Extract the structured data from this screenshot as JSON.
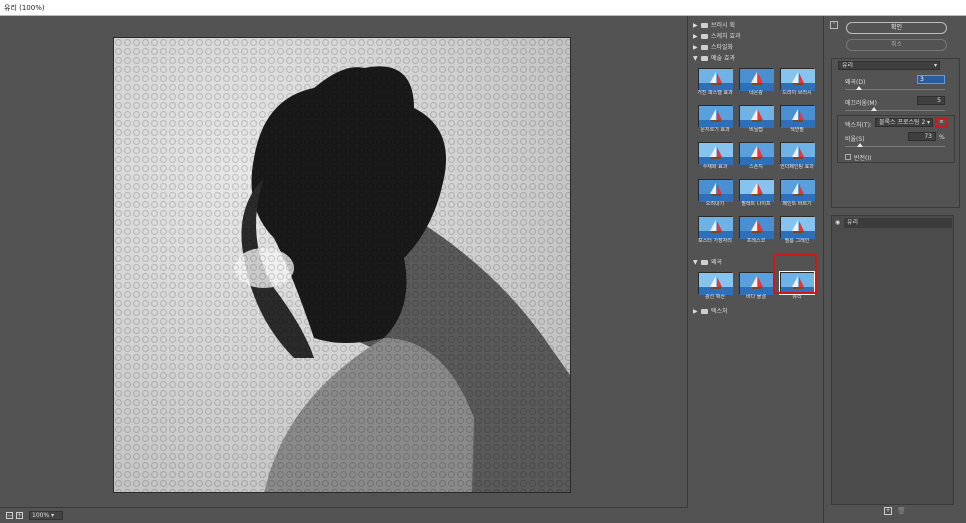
{
  "window": {
    "title": "유리 (100%)"
  },
  "preview": {
    "zoom": "100%"
  },
  "gallery": {
    "folders": [
      {
        "label": "브러시 획",
        "expanded": false
      },
      {
        "label": "스케치 효과",
        "expanded": false
      },
      {
        "label": "스타일화",
        "expanded": false
      },
      {
        "label": "예술 효과",
        "expanded": true
      },
      {
        "label": "왜곡",
        "expanded": true
      },
      {
        "label": "텍스처",
        "expanded": false
      }
    ],
    "artistic": [
      "거친 파스텔 효과",
      "네온광",
      "드라이 브러시",
      "문지르기 효과",
      "비닐랩",
      "색연필",
      "수채화 효과",
      "스폰지",
      "언더페인팅 효과",
      "오려내기",
      "팔레트 나이프",
      "페인트 바르기",
      "포스터 가장자리",
      "프레스코",
      "필름 그레인"
    ],
    "distort": [
      "광선 확산",
      "바다 물결",
      "유리"
    ],
    "selected": "유리"
  },
  "panel": {
    "ok": "확인",
    "cancel": "취소",
    "filter_select": "유리",
    "distortion_label": "왜곡(D)",
    "distortion_value": "3",
    "smoothness_label": "매끄러움(M)",
    "smoothness_value": "5",
    "texture_label": "텍스처(T):",
    "texture_value": "블록스 프로스팅 2",
    "scaling_label": "비율(S)",
    "scaling_value": "73",
    "scaling_unit": "%",
    "invert_label": "반전(I)",
    "layer_name": "유리"
  },
  "colors": {
    "accent_red": "#d01818",
    "focus_blue": "#2a5d9f"
  }
}
